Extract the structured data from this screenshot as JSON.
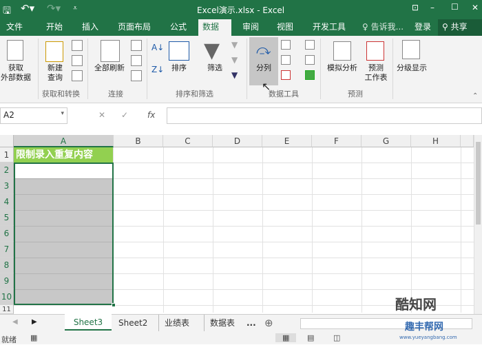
{
  "title_bar": {
    "title": "Excel演示.xlsx - Excel",
    "minimize": "–",
    "maximize": "☐",
    "close": "✕"
  },
  "tabs": [
    "文件",
    "开始",
    "插入",
    "页面布局",
    "公式",
    "数据",
    "审阅",
    "视图",
    "开发工具"
  ],
  "active_tab": "数据",
  "tell_me": "告诉我...",
  "login": "登录",
  "share": "共享",
  "ribbon": {
    "get_external": "获取\n外部数据",
    "new_query": "新建\n查询",
    "group_get": "获取和转换",
    "refresh_all": "全部刷新",
    "group_conn": "连接",
    "sort": "排序",
    "filter": "筛选",
    "group_sort": "排序和筛选",
    "text_to_columns": "分列",
    "group_tools": "数据工具",
    "what_if": "模拟分析",
    "forecast_sheet": "预测\n工作表",
    "group_forecast": "预测",
    "outline": "分级显示"
  },
  "formula_bar": {
    "name_box": "A2",
    "cancel": "✕",
    "enter": "✓",
    "fx": "fx",
    "formula": ""
  },
  "columns": [
    "A",
    "B",
    "C",
    "D",
    "E",
    "F",
    "G",
    "H"
  ],
  "rows": [
    "1",
    "2",
    "3",
    "4",
    "5",
    "6",
    "7",
    "8",
    "9",
    "10",
    "11"
  ],
  "cells": {
    "A1": "限制录入重复内容"
  },
  "sheet_tabs": [
    "Sheet3",
    "Sheet2",
    "业绩表",
    "数据表",
    "..."
  ],
  "active_sheet": "Sheet3",
  "status": "就绪",
  "watermark": [
    "酷知网",
    "趣丰帮网",
    "www.yueyangbang.com"
  ]
}
